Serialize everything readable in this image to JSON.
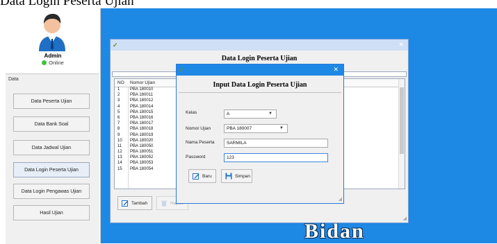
{
  "caption": "Data Login Peserta Ujian",
  "sidebar": {
    "user": {
      "name": "Admin",
      "status": "Online"
    },
    "panel_title": "Data",
    "menu": [
      {
        "label": "Data Peserta Ujian"
      },
      {
        "label": "Data Bank Soal"
      },
      {
        "label": "Data Jadwal Ujian"
      },
      {
        "label": "Data Login Peserta Ujian"
      },
      {
        "label": "Data Login Pengawas Ujian"
      },
      {
        "label": "Hasil Ujian"
      }
    ]
  },
  "background": {
    "brand": "Bidan"
  },
  "login_window": {
    "icon": "app-icon",
    "heading": "Data Login Peserta Ujian",
    "table": {
      "columns": [
        "NO",
        "Nomor Ujian"
      ],
      "rows": [
        [
          "1",
          "PBA 180010"
        ],
        [
          "2",
          "PBA 180011"
        ],
        [
          "3",
          "PBA 180012"
        ],
        [
          "4",
          "PBA 180014"
        ],
        [
          "5",
          "PBA 180015"
        ],
        [
          "6",
          "PBA 180016"
        ],
        [
          "7",
          "PBA 180017"
        ],
        [
          "8",
          "PBA 180018"
        ],
        [
          "9",
          "PBA 180019"
        ],
        [
          "10",
          "PBA 180020"
        ],
        [
          "11",
          "PBA 180050"
        ],
        [
          "12",
          "PBA 180051"
        ],
        [
          "13",
          "PBA 180052"
        ],
        [
          "14",
          "PBA 180053"
        ],
        [
          "15",
          "PBA 180054"
        ]
      ]
    },
    "buttons": {
      "add": "Tambah",
      "delete": "Hapus"
    }
  },
  "input_dialog": {
    "heading": "Input Data Login Peserta Ujian",
    "fields": {
      "kelas": {
        "label": "Kelas",
        "value": "A"
      },
      "nomor_ujian": {
        "label": "Nomor Ujian",
        "value": "PBA 180007"
      },
      "nama_peserta": {
        "label": "Nama Peserta",
        "value": "SARMILA"
      },
      "password": {
        "label": "Password",
        "value": "123"
      }
    },
    "buttons": {
      "new": "Baru",
      "save": "Simpan"
    }
  },
  "colors": {
    "accent": "#1e88e5",
    "desktop": "#1e88e5",
    "online": "#3cc43c"
  }
}
